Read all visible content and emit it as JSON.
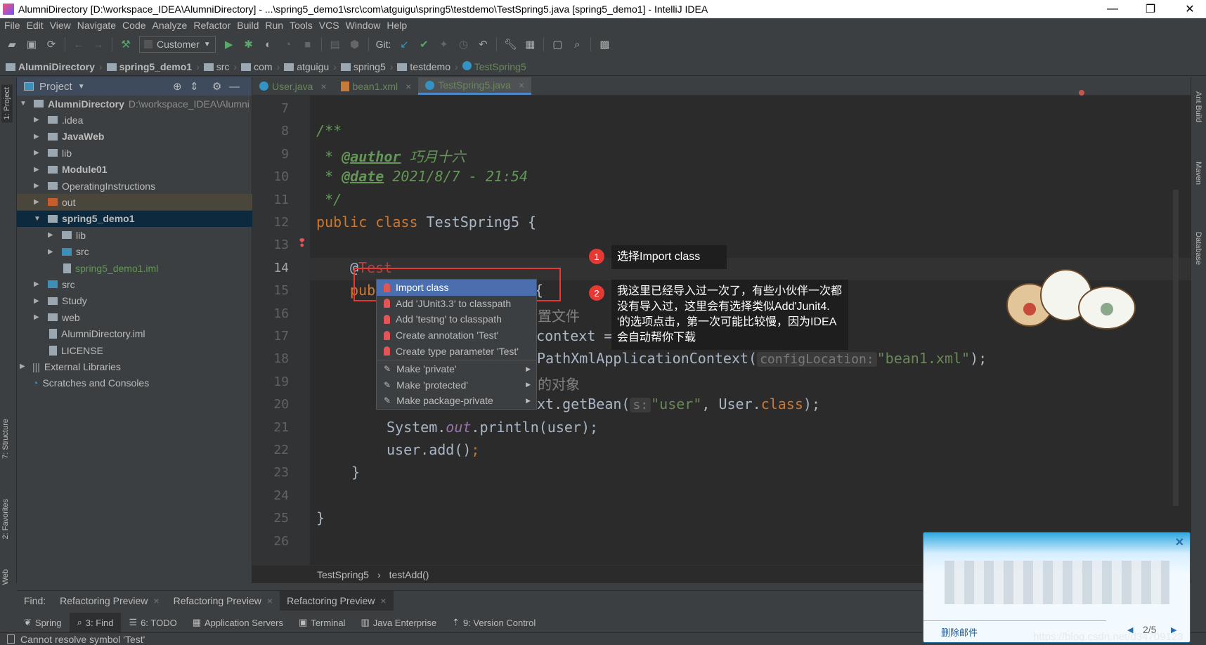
{
  "window": {
    "title": "AlumniDirectory [D:\\workspace_IDEA\\AlumniDirectory] - ...\\spring5_demo1\\src\\com\\atguigu\\spring5\\testdemo\\TestSpring5.java [spring5_demo1] - IntelliJ IDEA",
    "minimize": "—",
    "maximize": "❐",
    "close": "✕"
  },
  "menu": [
    "File",
    "Edit",
    "View",
    "Navigate",
    "Code",
    "Analyze",
    "Refactor",
    "Build",
    "Run",
    "Tools",
    "VCS",
    "Window",
    "Help"
  ],
  "toolbar": {
    "run_config": "Customer",
    "git_label": "Git:"
  },
  "breadcrumb": [
    "AlumniDirectory",
    "spring5_demo1",
    "src",
    "com",
    "atguigu",
    "spring5",
    "testdemo",
    "TestSpring5"
  ],
  "project": {
    "title": "Project",
    "tree": [
      {
        "label": "AlumniDirectory",
        "path": "D:\\workspace_IDEA\\Alumni",
        "depth": 0,
        "arrow": "▼",
        "bold": true
      },
      {
        "label": ".idea",
        "depth": 1,
        "arrow": "▶"
      },
      {
        "label": "JavaWeb",
        "depth": 1,
        "arrow": "▶",
        "bold": true
      },
      {
        "label": "lib",
        "depth": 1,
        "arrow": "▶"
      },
      {
        "label": "Module01",
        "depth": 1,
        "arrow": "▶",
        "bold": true
      },
      {
        "label": "OperatingInstructions",
        "depth": 1,
        "arrow": "▶"
      },
      {
        "label": "out",
        "depth": 1,
        "arrow": "▶",
        "folder": "#c75c2d",
        "bg": "#4a463c"
      },
      {
        "label": "spring5_demo1",
        "depth": 1,
        "arrow": "▼",
        "bold": true,
        "bg": "#0d293e"
      },
      {
        "label": "lib",
        "depth": 2,
        "arrow": "▶"
      },
      {
        "label": "src",
        "depth": 2,
        "arrow": "▶",
        "folder": "#3d8fb8"
      },
      {
        "label": "spring5_demo1.iml",
        "depth": 2,
        "arrow": "",
        "color": "#629755",
        "folder": "file"
      },
      {
        "label": "src",
        "depth": 1,
        "arrow": "▶",
        "folder": "#3d8fb8"
      },
      {
        "label": "Study",
        "depth": 1,
        "arrow": "▶"
      },
      {
        "label": "web",
        "depth": 1,
        "arrow": "▶"
      },
      {
        "label": "AlumniDirectory.iml",
        "depth": 1,
        "arrow": "",
        "folder": "file"
      },
      {
        "label": "LICENSE",
        "depth": 1,
        "arrow": "",
        "folder": "file"
      },
      {
        "label": "External Libraries",
        "depth": 0,
        "arrow": "▶",
        "folder": "lib"
      },
      {
        "label": "Scratches and Consoles",
        "depth": 0,
        "arrow": "",
        "folder": "scratch"
      }
    ]
  },
  "left_tabs": [
    "1: Project",
    "7: Structure",
    "2: Favorites",
    "Web"
  ],
  "right_tabs": [
    "Ant Build",
    "Maven",
    "Database"
  ],
  "editor_tabs": [
    {
      "label": "User.java"
    },
    {
      "label": "bean1.xml"
    },
    {
      "label": "TestSpring5.java",
      "active": true
    }
  ],
  "code": {
    "line_numbers": [
      "7",
      "8",
      "9",
      "10",
      "11",
      "12",
      "13",
      "14",
      "15",
      "16",
      "17",
      "18",
      "19",
      "20",
      "21",
      "22",
      "23",
      "24",
      "25",
      "26"
    ],
    "l8": "/**",
    "l9_star": " * ",
    "l9_tag": "@author",
    "l9_val": " 巧月十六",
    "l10_star": " * ",
    "l10_tag": "@date",
    "l10_val": " 2021/8/7 - 21:54",
    "l11": " */",
    "l12_kw": "public class ",
    "l12_rest": "TestSpring5 {",
    "l14_at": "@",
    "l14_ann": "Test",
    "l15_kw": "pub",
    "l15_brace": "{",
    "l16_frag": "置文件",
    "l17_frag": "t context =",
    "l18_frag": "PathXmlApplicationContext(",
    "l18_hint": "configLocation:",
    "l18_str": "\"bean1.xml\"",
    "l18_end": ");",
    "l19_frag": "的对象",
    "l20_frag": "xt.getBean(",
    "l20_hint": "s:",
    "l20_str": "\"user\"",
    "l20_mid": ", User.",
    "l20_kw": "class",
    "l20_end": ");",
    "l21_a": "System.",
    "l21_out": "out",
    "l21_b": ".println(user);",
    "l22_a": "user.add()",
    "l22_semi": ";",
    "l23": "}",
    "l25": "}"
  },
  "editor_breadcrumb": [
    "TestSpring5",
    "testAdd()"
  ],
  "popup": [
    {
      "label": "Import class",
      "icon": "bulb-red",
      "selected": true
    },
    {
      "label": "Add 'JUnit3.3' to classpath",
      "icon": "bulb-red"
    },
    {
      "label": "Add 'testng' to classpath",
      "icon": "bulb-red"
    },
    {
      "label": "Create annotation 'Test'",
      "icon": "bulb-red"
    },
    {
      "label": "Create type parameter 'Test'",
      "icon": "bulb-red"
    },
    {
      "label": "Make 'private'",
      "icon": "edit",
      "submenu": true
    },
    {
      "label": "Make 'protected'",
      "icon": "edit",
      "submenu": true
    },
    {
      "label": "Make package-private",
      "icon": "edit",
      "submenu": true
    }
  ],
  "annotations": [
    {
      "num": "1",
      "text": "选择Import class"
    },
    {
      "num": "2",
      "text": "我这里已经导入过一次了，有些小伙伴一次都没有导入过，这里会有选择类似Add'Junit4.  '的选项点击，第一次可能比较慢，因为IDEA会自动帮你下载"
    }
  ],
  "find_bar": {
    "label": "Find:",
    "tabs": [
      "Refactoring Preview",
      "Refactoring Preview",
      "Refactoring Preview"
    ]
  },
  "tool_windows": [
    {
      "label": "Spring"
    },
    {
      "label": "3: Find",
      "active": true
    },
    {
      "label": "6: TODO"
    },
    {
      "label": "Application Servers"
    },
    {
      "label": "Terminal"
    },
    {
      "label": "Java Enterprise"
    },
    {
      "label": "9: Version Control"
    }
  ],
  "status": "Cannot resolve symbol 'Test'",
  "notification": {
    "delete": "删除邮件",
    "page": "2/5",
    "close": "✕",
    "prev": "◀",
    "next": "▶"
  },
  "watermark": "https://blog.csdn.net/d34709123",
  "colors": {
    "accent": "#4b6eaf",
    "error": "#e53935",
    "keyword": "#cc7832",
    "string": "#6a8759"
  }
}
